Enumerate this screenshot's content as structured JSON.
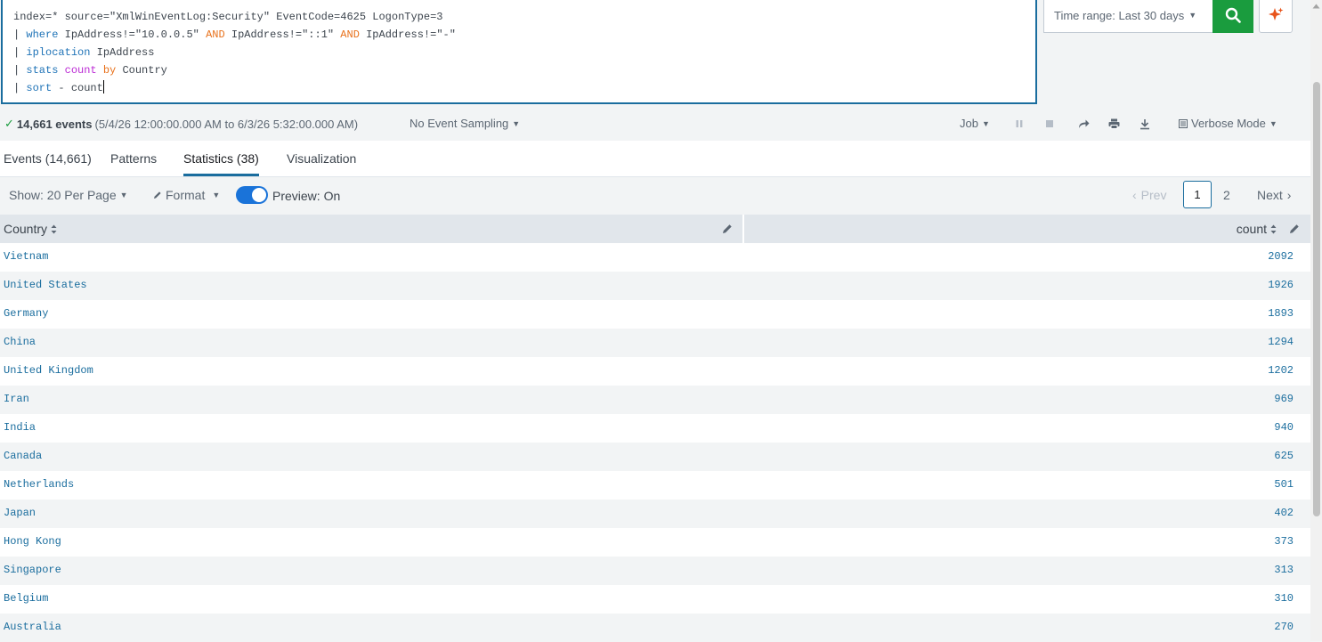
{
  "search": {
    "lines": [
      [
        {
          "t": "index=* source=\"XmlWinEventLog:Security\" EventCode=4625 LogonType=3",
          "c": ""
        }
      ],
      [
        {
          "t": "| ",
          "c": ""
        },
        {
          "t": "where",
          "c": "kw-cmd"
        },
        {
          "t": " IpAddress!=\"10.0.0.5\" ",
          "c": ""
        },
        {
          "t": "AND",
          "c": "kw-op"
        },
        {
          "t": " IpAddress!=\"::1\" ",
          "c": ""
        },
        {
          "t": "AND",
          "c": "kw-op"
        },
        {
          "t": " IpAddress!=\"-\"",
          "c": ""
        }
      ],
      [
        {
          "t": "| ",
          "c": ""
        },
        {
          "t": "iplocation",
          "c": "kw-cmd"
        },
        {
          "t": " IpAddress",
          "c": ""
        }
      ],
      [
        {
          "t": "| ",
          "c": ""
        },
        {
          "t": "stats",
          "c": "kw-cmd"
        },
        {
          "t": " ",
          "c": ""
        },
        {
          "t": "count",
          "c": "kw-fn"
        },
        {
          "t": " ",
          "c": ""
        },
        {
          "t": "by",
          "c": "kw-op"
        },
        {
          "t": " Country",
          "c": ""
        }
      ],
      [
        {
          "t": "| ",
          "c": ""
        },
        {
          "t": "sort",
          "c": "kw-cmd"
        },
        {
          "t": " - count",
          "c": ""
        }
      ]
    ],
    "time_range": "Time range: Last 30 days"
  },
  "job": {
    "event_count": "14,661 events",
    "range": "(5/4/26 12:00:00.000 AM to 6/3/26 5:32:00.000 AM)",
    "sampling": "No Event Sampling",
    "job_label": "Job",
    "mode": "Verbose Mode"
  },
  "tabs": {
    "events": "Events (14,661)",
    "patterns": "Patterns",
    "statistics": "Statistics (38)",
    "visualization": "Visualization"
  },
  "controls": {
    "show": "Show: 20 Per Page",
    "format": "Format",
    "preview": "Preview: On",
    "prev": "Prev",
    "page_current": "1",
    "page_other": "2",
    "next": "Next"
  },
  "table": {
    "col_country": "Country",
    "col_count": "count",
    "rows": [
      {
        "country": "Vietnam",
        "count": "2092"
      },
      {
        "country": "United States",
        "count": "1926"
      },
      {
        "country": "Germany",
        "count": "1893"
      },
      {
        "country": "China",
        "count": "1294"
      },
      {
        "country": "United Kingdom",
        "count": "1202"
      },
      {
        "country": "Iran",
        "count": "969"
      },
      {
        "country": "India",
        "count": "940"
      },
      {
        "country": "Canada",
        "count": "625"
      },
      {
        "country": "Netherlands",
        "count": "501"
      },
      {
        "country": "Japan",
        "count": "402"
      },
      {
        "country": "Hong Kong",
        "count": "373"
      },
      {
        "country": "Singapore",
        "count": "313"
      },
      {
        "country": "Belgium",
        "count": "310"
      },
      {
        "country": "Australia",
        "count": "270"
      }
    ]
  },
  "colors": {
    "accent": "#1a6d9e",
    "search_green": "#1a9c3e",
    "toggle_blue": "#1a73d9"
  },
  "icons": [
    "search-icon",
    "sparkle-icon",
    "check-icon",
    "pause-icon",
    "stop-icon",
    "share-icon",
    "print-icon",
    "download-icon",
    "pencil-icon",
    "sort-icon",
    "chevron-left-icon",
    "chevron-right-icon"
  ]
}
